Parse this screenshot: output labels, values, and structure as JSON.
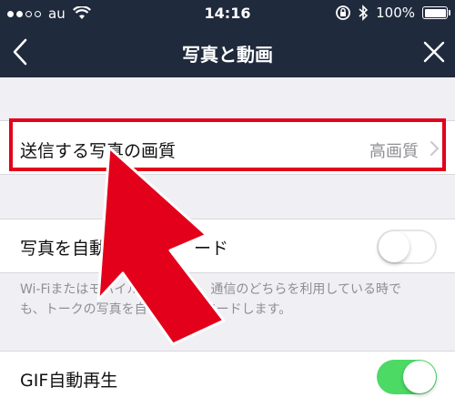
{
  "statusbar": {
    "carrier": "au",
    "time": "14:16",
    "battery_text": "100%",
    "icons": [
      "signal-dots",
      "wifi-icon",
      "orientation-lock-icon",
      "bluetooth-icon",
      "battery-icon"
    ]
  },
  "navbar": {
    "title": "写真と動画",
    "back_icon": "chevron-left-icon",
    "close_icon": "close-icon"
  },
  "settings": {
    "photo_quality": {
      "label": "送信する写真の画質",
      "value": "高画質"
    },
    "auto_download": {
      "label_visible_start": "写真を自動",
      "label_visible_end": "ード",
      "enabled": false,
      "description_line1_start": "Wi-Fiまたはモバイル",
      "description_line1_end": "通信のどちらを利用している時で",
      "description_line2_start": "も、トークの写真を自",
      "description_line2_end": "ダウンロードします。"
    },
    "gif_autoplay": {
      "label": "GIF自動再生",
      "enabled": true
    }
  },
  "annotation": {
    "highlight_color": "#e3001b",
    "arrow_color": "#e3001b"
  },
  "colors": {
    "navbar_bg": "#202a3d",
    "page_bg": "#efeff4",
    "toggle_on": "#4cd964",
    "secondary_text": "#8e8e93"
  }
}
